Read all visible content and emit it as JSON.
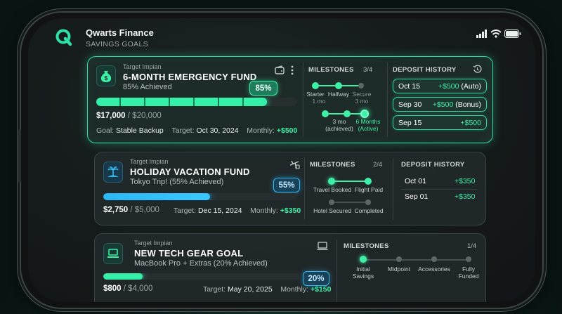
{
  "app": {
    "name": "Qwarts Finance",
    "section": "SAVINGS GOALS"
  },
  "goals": [
    {
      "tag": "Target Impian",
      "name": "6-MONTH EMERGENCY FUND",
      "subtitle": "85% Achieved",
      "percent_label": "85%",
      "progress": 0.85,
      "saved": "$17,000",
      "total": "/ $20,000",
      "goal_label": "Goal:",
      "goal_value": "Stable Backup",
      "target_label": "Target:",
      "target_value": "Oct 30, 2024",
      "monthly_label": "Monthly:",
      "monthly_value": "+$500",
      "milestones_title": "MILESTONES",
      "milestones_count": "3/4",
      "milestones": [
        "Starter",
        "Halfway",
        "Secure",
        "3 mo (achieved)",
        "6 Months (Active)"
      ],
      "milestone_sub": [
        "1 mo",
        "3 mo"
      ],
      "history_title": "DEPOSIT HISTORY",
      "deposits": [
        {
          "date": "Oct 15",
          "amount": "+$500",
          "note": "(Auto)"
        },
        {
          "date": "Sep 30",
          "amount": "+$500",
          "note": "(Bonus)"
        },
        {
          "date": "Sep 15",
          "amount": "+$500",
          "note": ""
        }
      ]
    },
    {
      "tag": "Target Impian",
      "name": "HOLIDAY VACATION FUND",
      "subtitle": "Tokyo Trip! (55% Achieved)",
      "percent_label": "55%",
      "progress": 0.55,
      "saved": "$2,750",
      "total": "/ $5,000",
      "target_label": "Target:",
      "target_value": "Dec 15, 2024",
      "monthly_label": "Monthly:",
      "monthly_value": "+$350",
      "milestones_title": "MILESTONES",
      "milestones_count": "2/4",
      "milestones": [
        "Travel Booked",
        "Flight Paid",
        "Hotel Secured",
        "Completed"
      ],
      "history_title": "DEPOSIT HISTORY",
      "deposits": [
        {
          "date": "Oct 01",
          "amount": "+$350"
        },
        {
          "date": "Sep 01",
          "amount": "+$350"
        }
      ]
    },
    {
      "tag": "Target Impian",
      "name": "NEW TECH GEAR GOAL",
      "subtitle": "MacBook Pro + Extras (20% Achieved)",
      "percent_label": "20%",
      "progress": 0.2,
      "saved": "$800",
      "total": "/ $4,000",
      "target_label": "Target:",
      "target_value": "May 20, 2025",
      "monthly_label": "Monthly:",
      "monthly_value": "+$150",
      "milestones_title": "MILESTONES",
      "milestones_count": "1/4",
      "milestones": [
        "Initial Savings",
        "Midpoint",
        "Accessories",
        "Fully Funded"
      ]
    }
  ],
  "colors": {
    "accent": "#2fe0a8",
    "accent_blue": "#35b8f0",
    "fill_green": "#34f0a8",
    "fill_blue": "#2bb8f5"
  }
}
